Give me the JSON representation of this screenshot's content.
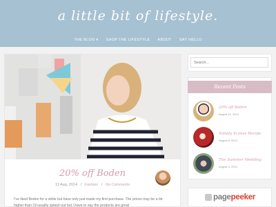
{
  "header": {
    "title": "a little bit of lifestyle.",
    "nav": [
      "THE BLOG ▾",
      "SHOP THE LIFESTYLE",
      "ABOUT",
      "SAY HELLO"
    ]
  },
  "post": {
    "title": "20% off Boden",
    "date": "11 Aug, 2014",
    "category": "Fashion",
    "comments": "No Comments",
    "excerpt": "I've liked Boden for a while but have only just made my first purchase. The prices may be a bit higher than I'd usually splash out but I have to say the products are great"
  },
  "sidebar": {
    "search_placeholder": "Search...",
    "recent_title": "Recent Posts",
    "recent": [
      {
        "title": "20% off Boden",
        "date": "August 11, 2014"
      },
      {
        "title": "Simply Scones Recipe",
        "date": "August 8, 2014"
      },
      {
        "title": "The Summer Wedding",
        "date": "August 4, 2014"
      }
    ]
  },
  "watermark": {
    "text_main": "page",
    "text_accent": "peeker"
  },
  "colors": {
    "header": "#a6c1d1",
    "accent_pink": "#d59aab",
    "widget_title": "#d8bcc5"
  }
}
